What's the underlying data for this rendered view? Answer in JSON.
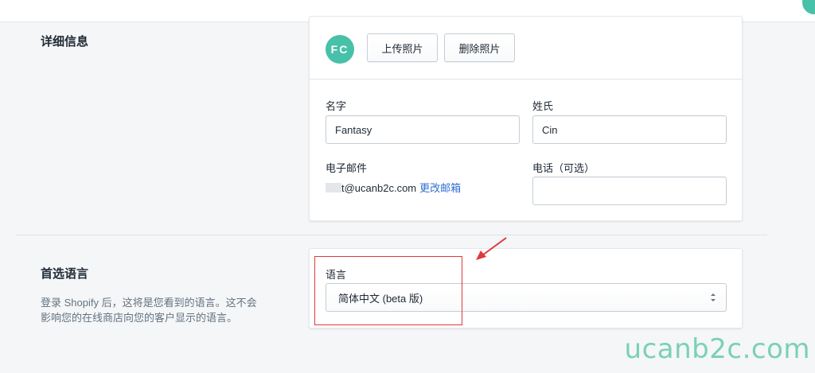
{
  "details_section": {
    "title": "详细信息",
    "avatar_initials": "FC",
    "upload_photo_label": "上传照片",
    "delete_photo_label": "删除照片",
    "first_name_label": "名字",
    "first_name_value": "Fantasy",
    "last_name_label": "姓氏",
    "last_name_value": "Cin",
    "email_label": "电子邮件",
    "email_value": "t@ucanb2c.com",
    "change_email_link": "更改邮箱",
    "phone_label": "电话（可选）",
    "phone_value": ""
  },
  "language_section": {
    "title": "首选语言",
    "description": "登录 Shopify 后，这将是您看到的语言。这不会影响您的在线商店向您的客户显示的语言。",
    "language_label": "语言",
    "language_selected": "简体中文 (beta 版)"
  },
  "watermark": "ucanb2c.com",
  "colors": {
    "avatar": "#47c1a8",
    "link": "#2e6ed3",
    "annotation": "#e03a3a",
    "watermark": "#7cd0b4"
  }
}
